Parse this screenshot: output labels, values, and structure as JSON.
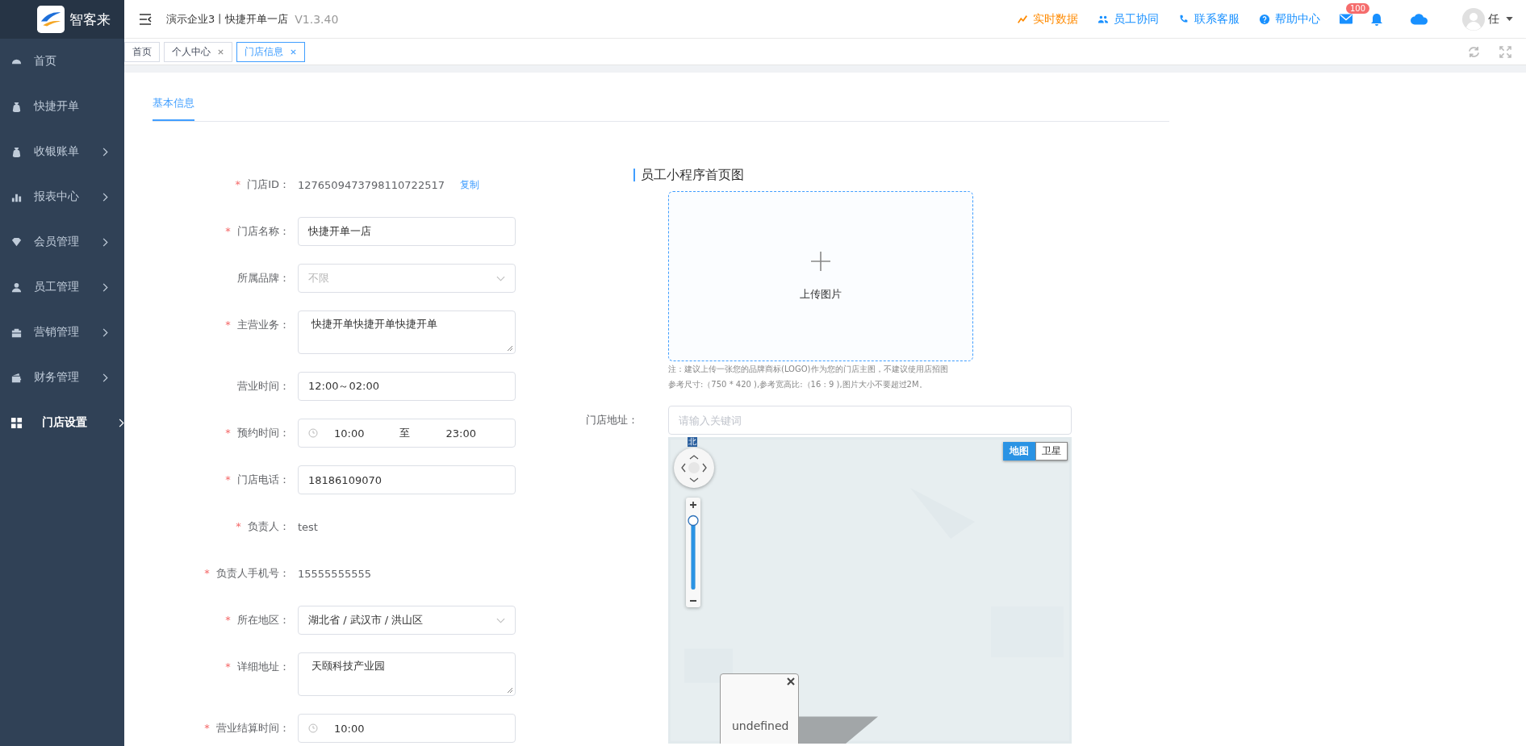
{
  "brand": {
    "name": "智客来"
  },
  "sidebar": {
    "items": [
      {
        "label": "首页",
        "has_arrow": false,
        "selected": false
      },
      {
        "label": "快捷开单",
        "has_arrow": false,
        "selected": false
      },
      {
        "label": "收银账单",
        "has_arrow": true,
        "selected": false
      },
      {
        "label": "报表中心",
        "has_arrow": true,
        "selected": false
      },
      {
        "label": "会员管理",
        "has_arrow": true,
        "selected": false
      },
      {
        "label": "员工管理",
        "has_arrow": true,
        "selected": false
      },
      {
        "label": "营销管理",
        "has_arrow": true,
        "selected": false
      },
      {
        "label": "财务管理",
        "has_arrow": true,
        "selected": false
      },
      {
        "label": "门店设置",
        "has_arrow": true,
        "selected": true
      }
    ]
  },
  "header": {
    "title": "演示企业3丨快捷开单一店",
    "version": "V1.3.40",
    "links": [
      {
        "label": "实时数据",
        "color": "#ff8a00"
      },
      {
        "label": "员工协同",
        "color": "#1890ff"
      },
      {
        "label": "联系客服",
        "color": "#1890ff"
      },
      {
        "label": "帮助中心",
        "color": "#1890ff"
      }
    ],
    "mail_badge": "100",
    "user": "任"
  },
  "tabs": [
    {
      "label": "首页",
      "closable": false,
      "selected": false
    },
    {
      "label": "个人中心",
      "closable": true,
      "selected": false
    },
    {
      "label": "门店信息",
      "closable": true,
      "selected": true
    }
  ],
  "section_tabs": [
    {
      "label": "基本信息",
      "selected": true
    }
  ],
  "form": {
    "fields": [
      {
        "kind": "static",
        "mark": "*",
        "label": "门店ID：",
        "value": "1276509473798110722517",
        "link": "复制"
      },
      {
        "kind": "input",
        "mark": "*",
        "label": "门店名称：",
        "value": "快捷开单一店"
      },
      {
        "kind": "select",
        "label": "所属品牌：",
        "placeholder": "不限"
      },
      {
        "kind": "textarea",
        "mark": "*",
        "label": "主营业务：",
        "value": "快捷开单快捷开单快捷开单"
      },
      {
        "kind": "input",
        "label": "营业时间：",
        "value": "12:00～02:00"
      },
      {
        "kind": "time-range",
        "mark": "*",
        "label": "预约时间：",
        "start": "10:00",
        "separator": "至",
        "end": "23:00"
      },
      {
        "kind": "input",
        "mark": "*",
        "label": "门店电话：",
        "value": "18186109070"
      },
      {
        "kind": "static",
        "mark": "*",
        "label": "负责人：",
        "value": "test"
      },
      {
        "kind": "static",
        "mark": "*",
        "label": "负责人手机号：",
        "value": "15555555555"
      },
      {
        "kind": "select",
        "mark": "*",
        "label": "所在地区：",
        "value": "湖北省 / 武汉市 / 洪山区"
      },
      {
        "kind": "textarea",
        "mark": "*",
        "label": "详细地址：",
        "value": "天颐科技产业园"
      },
      {
        "kind": "time",
        "mark": "*",
        "label": "营业结算时间：",
        "value": "10:00"
      }
    ]
  },
  "upload": {
    "title": "员工小程序首页图",
    "button": "上传图片",
    "notes": [
      "注：建议上传一张您的品牌商标(LOGO)作为您的门店主图，不建议使用店招图",
      "参考尺寸:（750 * 420 ),参考宽高比:（16 : 9 ),图片大小不要超过2M。"
    ]
  },
  "address": {
    "label": "门店地址：",
    "placeholder": "请输入关键词"
  },
  "map": {
    "north": "北",
    "zoom_slider": {
      "level": 0.95
    },
    "types": [
      {
        "label": "地图",
        "selected": true
      },
      {
        "label": "卫星",
        "selected": false
      }
    ],
    "popup": "undefined"
  }
}
